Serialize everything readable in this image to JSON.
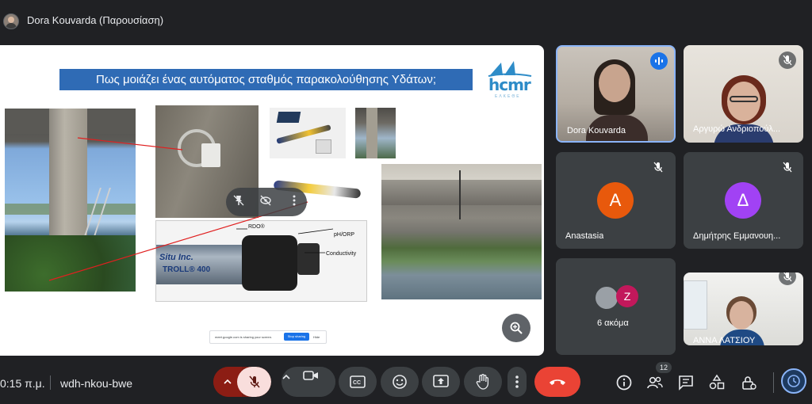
{
  "window": {
    "title": "Dora Kouvarda (Παρουσίαση)"
  },
  "slide": {
    "title": "Πως μοιάζει ένας αυτόματος σταθμός παρακολούθησης Υδάτων;",
    "logo_text": "hcmr",
    "logo_subtext": "ΕΛΚΕΘΕ",
    "sonde_labels": {
      "rdo": "RDO®",
      "ph": "pH/ORP",
      "conductivity": "Conductivity",
      "brand": "Situ Inc.",
      "model": "TROLL® 400"
    },
    "share_banner": {
      "text": "meet.google.com is sharing your screen.",
      "stop_label": "Stop sharing",
      "hide_label": "Hide"
    }
  },
  "tiles": [
    {
      "name": "Dora Kouvarda"
    },
    {
      "name": "Αργυρώ Ανδριοπούλ..."
    },
    {
      "name": "Anastasia",
      "initial": "A",
      "color": "#e8590c"
    },
    {
      "name": "Δημήτρης Εμμανουη...",
      "initial": "Δ",
      "color": "#a142f4"
    },
    {
      "name": "6 ακόμα",
      "mini_initial": "Z",
      "mini_color": "#c2185b"
    },
    {
      "name": "ΑΝΝΑ ΛΑΤΣΙΟΥ"
    }
  ],
  "meeting": {
    "time": "0:15 π.μ.",
    "separator": "|",
    "code": "wdh-nkou-bwe",
    "participant_count": "12"
  },
  "colors": {
    "background": "#202124",
    "tile": "#3c4043",
    "end_call": "#ea4335",
    "mic_off": "#f9dedc",
    "accent": "#8ab4f8",
    "slide_title_bg": "#2f6bb5"
  },
  "icons": {
    "mic_off": "mic-off-icon",
    "camera": "videocam-icon",
    "captions": "closed-caption-icon",
    "emoji": "emoji-icon",
    "present": "present-screen-icon",
    "raise_hand": "raise-hand-icon",
    "more": "more-vert-icon",
    "end_call": "call-end-icon",
    "info": "info-icon",
    "people": "people-icon",
    "chat": "chat-icon",
    "activities": "activities-icon",
    "host_controls": "host-controls-icon"
  }
}
